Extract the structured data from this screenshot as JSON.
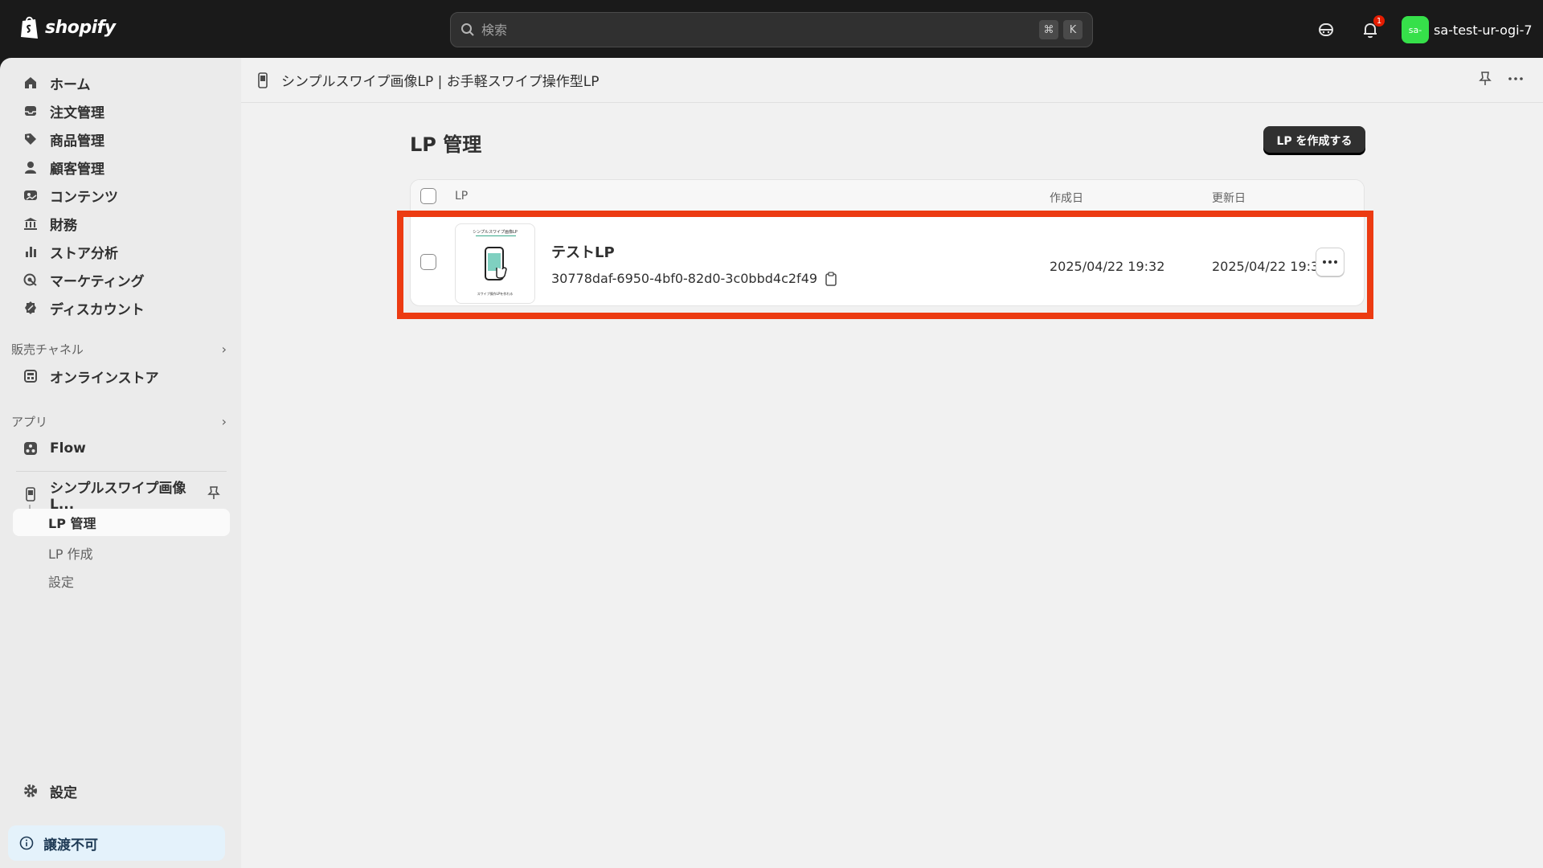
{
  "topbar": {
    "brand": "shopify",
    "search_placeholder": "検索",
    "shortcut_keys": [
      "⌘",
      "K"
    ],
    "notification_count": "1",
    "store_avatar": "sa-",
    "store_name": "sa-test-ur-ogi-7",
    "icons": [
      "shopify-bag-icon",
      "search-icon",
      "sidekick-icon",
      "bell-icon"
    ]
  },
  "sidebar": {
    "items": [
      {
        "label": "ホーム",
        "icon": "home-icon"
      },
      {
        "label": "注文管理",
        "icon": "inbox-icon"
      },
      {
        "label": "商品管理",
        "icon": "tag-icon"
      },
      {
        "label": "顧客管理",
        "icon": "person-icon"
      },
      {
        "label": "コンテンツ",
        "icon": "image-icon"
      },
      {
        "label": "財務",
        "icon": "bank-icon"
      },
      {
        "label": "ストア分析",
        "icon": "bar-chart-icon"
      },
      {
        "label": "マーケティング",
        "icon": "target-icon"
      },
      {
        "label": "ディスカウント",
        "icon": "discount-icon"
      }
    ],
    "sales_channels": {
      "title": "販売チャネル",
      "items": [
        {
          "label": "オンラインストア",
          "icon": "store-icon"
        }
      ]
    },
    "apps": {
      "title": "アプリ",
      "items": [
        {
          "label": "Flow",
          "icon": "flow-icon"
        }
      ]
    },
    "pinned_app": {
      "label": "シンプルスワイプ画像L...",
      "sub_items": [
        "LP 管理",
        "LP 作成",
        "設定"
      ]
    },
    "settings_label": "設定",
    "notice_label": "譲渡不可"
  },
  "appbar": {
    "title": "シンプルスワイプ画像LP | お手軽スワイプ操作型LP"
  },
  "page": {
    "title": "LP 管理",
    "create_button": "LP を作成する"
  },
  "table": {
    "headers": {
      "lp": "LP",
      "created": "作成日",
      "updated": "更新日"
    },
    "rows": [
      {
        "name": "テストLP",
        "id": "30778daf-6950-4bf0-82d0-3c0bbd4c2f49",
        "created": "2025/04/22 19:32",
        "updated": "2025/04/22 19:32",
        "thumb_title": "シンプルスワイプ画像LP",
        "thumb_caption": "スワイプ操作LPを作れる"
      }
    ]
  },
  "colors": {
    "topbar_bg": "#1a1a1a",
    "sidebar_bg": "#ebebeb",
    "main_bg": "#f1f1f1",
    "highlight": "#ec3b12",
    "avatar": "#36e04a",
    "badge": "#e51c00"
  }
}
